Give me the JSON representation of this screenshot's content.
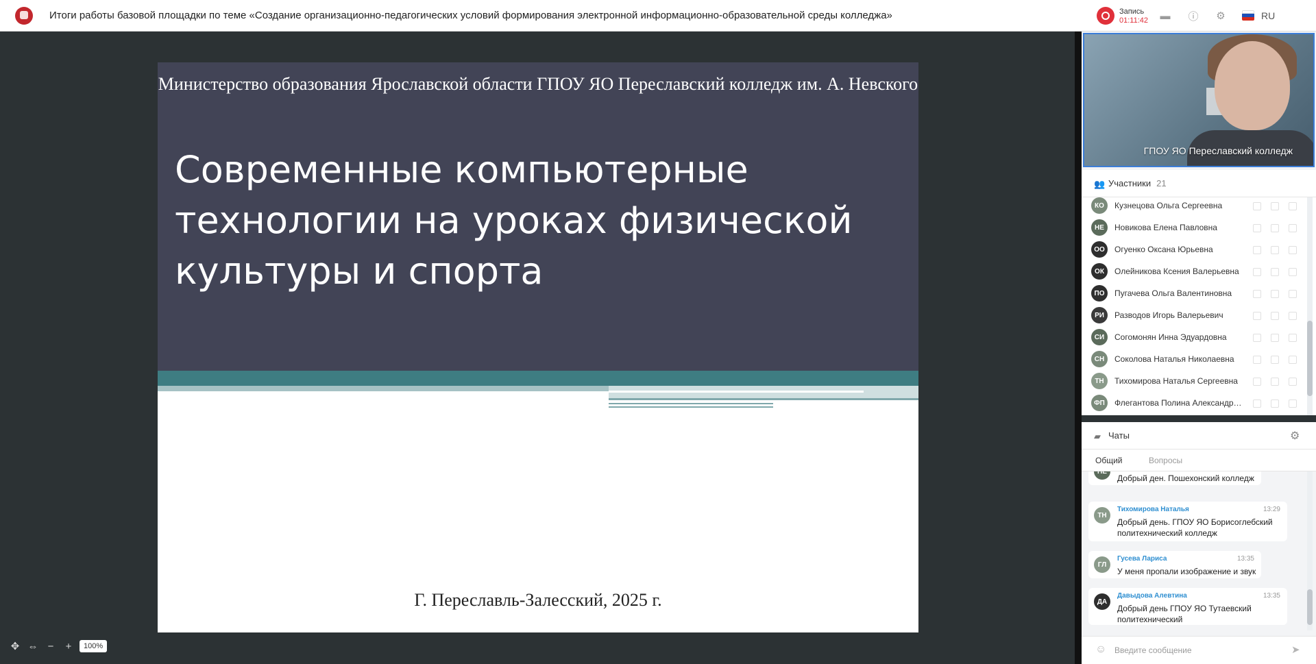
{
  "app": {
    "title": "Итоги работы базовой площадки по теме «Создание организационно-педагогических условий формирования электронной информационно-образовательной среды колледжа»",
    "recording_label": "Запись",
    "recording_time": "01:11:42",
    "language": "RU",
    "icons": [
      "folder-icon",
      "info-icon",
      "settings-icon",
      "flag-ru-icon"
    ]
  },
  "slide": {
    "ministry": "Министерство образования Ярославской области ГПОУ ЯО Переславский колледж им. А. Невского",
    "title": "Современные компьютерные технологии на уроках физической культуры и спорта",
    "footer": "Г. Переславль-Залесский, 2025 г.",
    "colors": {
      "header": "#424456",
      "band": "#3e7d82",
      "stripe": "#a6c2c4"
    }
  },
  "zoom": {
    "level": "100%"
  },
  "video": {
    "label": "ГПОУ ЯО Переславский колледж"
  },
  "participants": {
    "label": "Участники",
    "count": "21",
    "items": [
      {
        "initials": "КО",
        "name": "Кузнецова Ольга Сергеевна",
        "color": "#7a8a7a"
      },
      {
        "initials": "НЕ",
        "name": "Новикова Елена Павловна",
        "color": "#5b6b5b"
      },
      {
        "initials": "ОО",
        "name": "Огуенко Оксана Юрьевна",
        "color": "#2e2e2e"
      },
      {
        "initials": "ОК",
        "name": "Олейникова Ксения Валерьевна",
        "color": "#2e2e2e"
      },
      {
        "initials": "ПО",
        "name": "Пугачева Ольга Валентиновна",
        "color": "#2e2e2e"
      },
      {
        "initials": "РИ",
        "name": "Разводов Игорь Валерьевич",
        "color": "#3a3a3a"
      },
      {
        "initials": "СИ",
        "name": "Согомонян Инна Эдуардовна",
        "color": "#5b6b5b"
      },
      {
        "initials": "СН",
        "name": "Соколова Наталья Николаевна",
        "color": "#7a8a7a"
      },
      {
        "initials": "ТН",
        "name": "Тихомирова Наталья Сергеевна",
        "color": "#8a9a8a"
      },
      {
        "initials": "ФП",
        "name": "Флегантова Полина Александро...",
        "color": "#7a8a7a"
      }
    ]
  },
  "chats": {
    "label": "Чаты",
    "tabs": [
      {
        "label": "Общий"
      },
      {
        "label": "Вопросы"
      }
    ],
    "messages": [
      {
        "initials": "НЕ",
        "author": "",
        "time": "",
        "text": "Добрый ден. Пошехонский колледж",
        "color": "#5b6b5b"
      },
      {
        "initials": "ТН",
        "author": "Тихомирова Наталья",
        "time": "13:29",
        "text": "Добрый день. ГПОУ ЯО Борисоглебский политехнический колледж",
        "color": "#8a9a8a"
      },
      {
        "initials": "ГЛ",
        "author": "Гусева Лариса",
        "time": "13:35",
        "text": "У меня пропали изображение и звук",
        "color": "#8a9a8a"
      },
      {
        "initials": "ДА",
        "author": "Давыдова Алевтина",
        "time": "13:35",
        "text": "Добрый день ГПОУ ЯО Тутаевский политехнический",
        "color": "#2e2e2e"
      }
    ],
    "input_placeholder": "Введите сообщение"
  }
}
